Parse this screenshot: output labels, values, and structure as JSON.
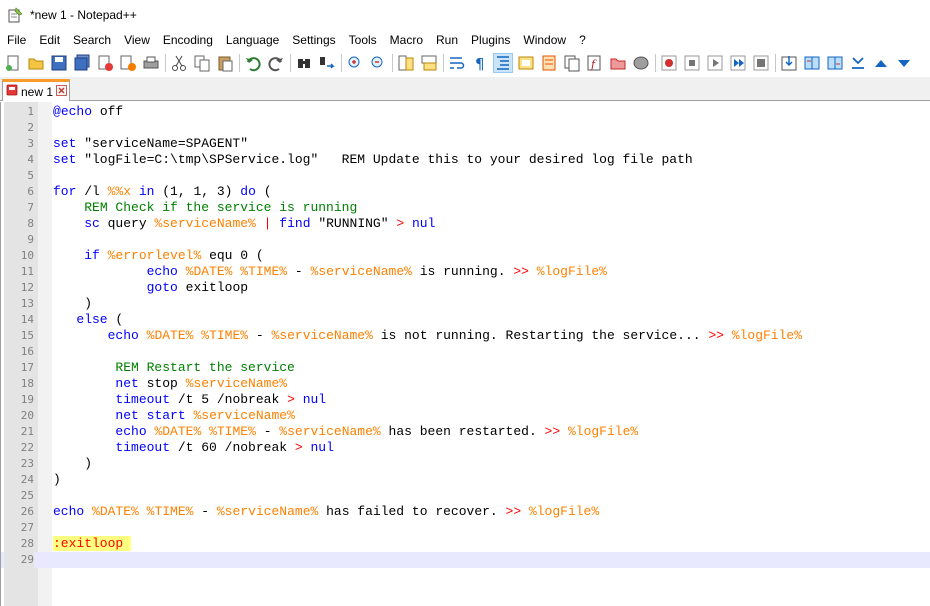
{
  "window": {
    "title": "*new 1 - Notepad++"
  },
  "menu": [
    "File",
    "Edit",
    "Search",
    "View",
    "Encoding",
    "Language",
    "Settings",
    "Tools",
    "Macro",
    "Run",
    "Plugins",
    "Window",
    "?"
  ],
  "toolbar": {
    "icons": [
      "new-file-icon",
      "open-file-icon",
      "save-icon",
      "save-all-icon",
      "close-icon",
      "close-all-icon",
      "print-icon",
      "cut-icon",
      "copy-icon",
      "paste-icon",
      "undo-icon",
      "redo-icon",
      "find-icon",
      "replace-icon",
      "zoom-in-icon",
      "zoom-out-icon",
      "sync-vertical-icon",
      "sync-horizontal-icon",
      "word-wrap-icon",
      "show-all-characters-icon",
      "indent-guide-icon",
      "user-defined-language-icon",
      "document-map-icon",
      "document-list-icon",
      "function-list-icon",
      "folder-as-workspace-icon",
      "monitoring-icon",
      "record-macro-icon",
      "stop-recording-icon",
      "playback-macro-icon",
      "run-macro-multiple-icon",
      "save-macro-icon",
      "spell-check-icon",
      "compare-icon",
      "compare-clear-icon",
      "compare-first-icon",
      "compare-prev-icon",
      "compare-next-icon"
    ]
  },
  "tab": {
    "label": "new 1",
    "close_icon": "close-tab-icon"
  },
  "colors": {
    "keyword": "#0000ff",
    "comment": "#008000",
    "variable": "#ff8000",
    "operator": "#ff0000",
    "current_line": "#e8e8ff",
    "label_background": "#ffff80"
  },
  "editor": {
    "current_line": 29,
    "lines": [
      [
        [
          "kw",
          "@"
        ],
        [
          "kw",
          "echo"
        ],
        [
          "dflt",
          " off"
        ]
      ],
      [],
      [
        [
          "kw",
          "set"
        ],
        [
          "dflt",
          " \"serviceName=SPAGENT\""
        ]
      ],
      [
        [
          "kw",
          "set"
        ],
        [
          "dflt",
          " \"logFile=C:\\tmp\\SPService.log\"   REM Update this to your desired log file path"
        ]
      ],
      [],
      [
        [
          "kw",
          "for"
        ],
        [
          "dflt",
          " /l "
        ],
        [
          "vr",
          "%%x"
        ],
        [
          "dflt",
          " "
        ],
        [
          "kw",
          "in"
        ],
        [
          "dflt",
          " (1, 1, 3) "
        ],
        [
          "kw",
          "do"
        ],
        [
          "dflt",
          " ("
        ]
      ],
      [
        [
          "dflt",
          "    "
        ],
        [
          "cm",
          "REM Check if the service is running"
        ]
      ],
      [
        [
          "dflt",
          "    "
        ],
        [
          "kw",
          "sc"
        ],
        [
          "dflt",
          " query "
        ],
        [
          "vr",
          "%serviceName%"
        ],
        [
          "dflt",
          " "
        ],
        [
          "op",
          "|"
        ],
        [
          "dflt",
          " "
        ],
        [
          "kw",
          "find"
        ],
        [
          "dflt",
          " \"RUNNING\" "
        ],
        [
          "op",
          ">"
        ],
        [
          "dflt",
          " "
        ],
        [
          "kw",
          "nul"
        ]
      ],
      [],
      [
        [
          "dflt",
          "    "
        ],
        [
          "kw",
          "if"
        ],
        [
          "dflt",
          " "
        ],
        [
          "vr",
          "%errorlevel%"
        ],
        [
          "dflt",
          " equ 0 ("
        ]
      ],
      [
        [
          "dflt",
          "            "
        ],
        [
          "kw",
          "echo"
        ],
        [
          "dflt",
          " "
        ],
        [
          "vr",
          "%DATE%"
        ],
        [
          "dflt",
          " "
        ],
        [
          "vr",
          "%TIME%"
        ],
        [
          "dflt",
          " - "
        ],
        [
          "vr",
          "%serviceName%"
        ],
        [
          "dflt",
          " is running. "
        ],
        [
          "op",
          ">>"
        ],
        [
          "dflt",
          " "
        ],
        [
          "vr",
          "%logFile%"
        ]
      ],
      [
        [
          "dflt",
          "            "
        ],
        [
          "kw",
          "goto"
        ],
        [
          "dflt",
          " exitloop"
        ]
      ],
      [
        [
          "dflt",
          "    )"
        ]
      ],
      [
        [
          "dflt",
          "   "
        ],
        [
          "kw",
          "else"
        ],
        [
          "dflt",
          " ("
        ]
      ],
      [
        [
          "dflt",
          "       "
        ],
        [
          "kw",
          "echo"
        ],
        [
          "dflt",
          " "
        ],
        [
          "vr",
          "%DATE%"
        ],
        [
          "dflt",
          " "
        ],
        [
          "vr",
          "%TIME%"
        ],
        [
          "dflt",
          " - "
        ],
        [
          "vr",
          "%serviceName%"
        ],
        [
          "dflt",
          " is not running. Restarting the service... "
        ],
        [
          "op",
          ">>"
        ],
        [
          "dflt",
          " "
        ],
        [
          "vr",
          "%logFile%"
        ]
      ],
      [],
      [
        [
          "dflt",
          "        "
        ],
        [
          "cm",
          "REM Restart the service"
        ]
      ],
      [
        [
          "dflt",
          "        "
        ],
        [
          "kw",
          "net"
        ],
        [
          "dflt",
          " stop "
        ],
        [
          "vr",
          "%serviceName%"
        ]
      ],
      [
        [
          "dflt",
          "        "
        ],
        [
          "kw",
          "timeout"
        ],
        [
          "dflt",
          " /t 5 /nobreak "
        ],
        [
          "op",
          ">"
        ],
        [
          "dflt",
          " "
        ],
        [
          "kw",
          "nul"
        ]
      ],
      [
        [
          "dflt",
          "        "
        ],
        [
          "kw",
          "net"
        ],
        [
          "dflt",
          " "
        ],
        [
          "kw",
          "start"
        ],
        [
          "dflt",
          " "
        ],
        [
          "vr",
          "%serviceName%"
        ]
      ],
      [
        [
          "dflt",
          "        "
        ],
        [
          "kw",
          "echo"
        ],
        [
          "dflt",
          " "
        ],
        [
          "vr",
          "%DATE%"
        ],
        [
          "dflt",
          " "
        ],
        [
          "vr",
          "%TIME%"
        ],
        [
          "dflt",
          " - "
        ],
        [
          "vr",
          "%serviceName%"
        ],
        [
          "dflt",
          " has been restarted. "
        ],
        [
          "op",
          ">>"
        ],
        [
          "dflt",
          " "
        ],
        [
          "vr",
          "%logFile%"
        ]
      ],
      [
        [
          "dflt",
          "        "
        ],
        [
          "kw",
          "timeout"
        ],
        [
          "dflt",
          " /t 60 /nobreak "
        ],
        [
          "op",
          ">"
        ],
        [
          "dflt",
          " "
        ],
        [
          "kw",
          "nul"
        ]
      ],
      [
        [
          "dflt",
          "    )"
        ]
      ],
      [
        [
          "dflt",
          ")"
        ]
      ],
      [],
      [
        [
          "kw",
          "echo"
        ],
        [
          "dflt",
          " "
        ],
        [
          "vr",
          "%DATE%"
        ],
        [
          "dflt",
          " "
        ],
        [
          "vr",
          "%TIME%"
        ],
        [
          "dflt",
          " - "
        ],
        [
          "vr",
          "%serviceName%"
        ],
        [
          "dflt",
          " has failed to recover. "
        ],
        [
          "op",
          ">>"
        ],
        [
          "dflt",
          " "
        ],
        [
          "vr",
          "%logFile%"
        ]
      ],
      [],
      [
        [
          "lbl",
          ":exitloop "
        ]
      ],
      []
    ]
  }
}
